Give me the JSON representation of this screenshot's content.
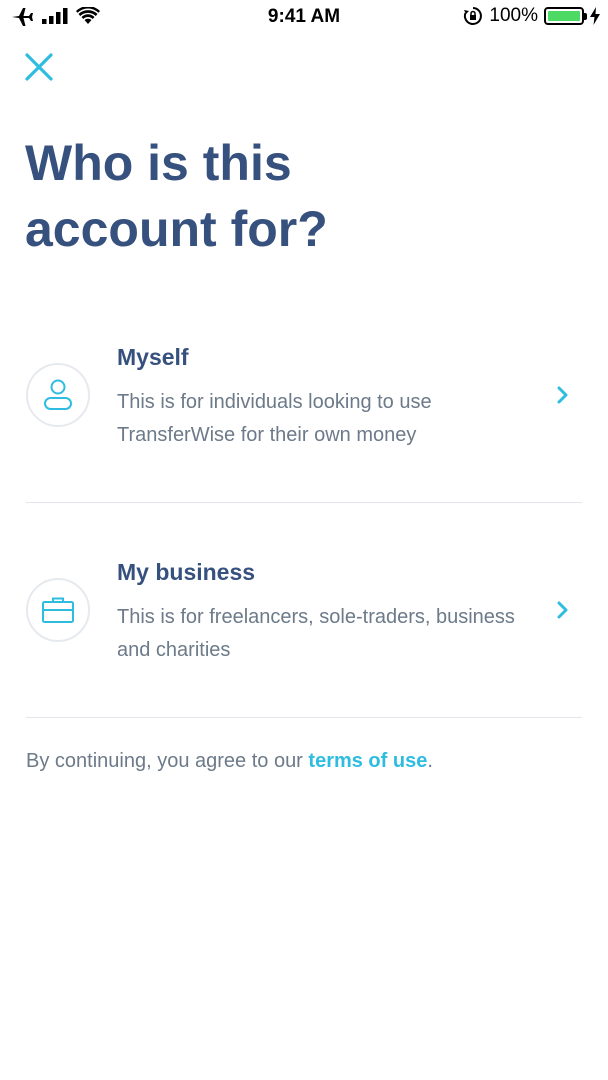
{
  "status_bar": {
    "time": "9:41 AM",
    "battery_percent": "100%",
    "battery_level": 1.0,
    "icons": [
      "airplane-icon",
      "signal-icon",
      "wifi-icon",
      "rotation-lock-icon",
      "battery-icon",
      "charging-icon"
    ]
  },
  "header": {
    "close_icon": "close-icon",
    "title": "Who is this account for?"
  },
  "options": [
    {
      "title": "Myself",
      "description": "This is for individuals looking to use TransferWise for their own money",
      "icon": "person-icon"
    },
    {
      "title": "My business",
      "description": "This is for freelancers, sole-traders, business and charities",
      "icon": "briefcase-icon"
    }
  ],
  "terms": {
    "prefix": "By continuing, you agree to our ",
    "link": "terms of use",
    "suffix": "."
  },
  "colors": {
    "title": "#37517e",
    "body_text": "#6c7a89",
    "accent": "#2ebde0",
    "divider": "#e2e6ea",
    "battery": "#4cd964"
  }
}
